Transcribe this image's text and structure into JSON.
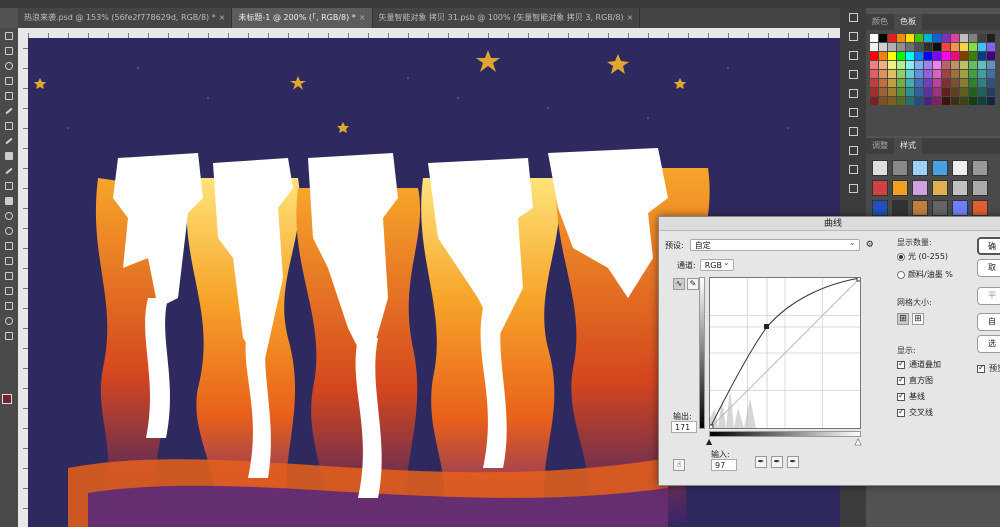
{
  "tabs": [
    {
      "label": "热浪来袭.psd @ 153% (56fe2f778629d, RGB/8) *",
      "active": false
    },
    {
      "label": "未标题-1 @ 200% (「, RGB/8) *",
      "active": true
    },
    {
      "label": "矢量智能对象 拷贝 31.psb @ 100% (矢量智能对象 拷贝 3, RGB/8)",
      "active": false
    }
  ],
  "tab_close": "×",
  "panels": {
    "swatches": {
      "tabs": [
        "颜色",
        "色板"
      ],
      "active": "色板"
    },
    "styles": {
      "tabs": [
        "调整",
        "样式"
      ],
      "active": "样式"
    }
  },
  "curves": {
    "title": "曲线",
    "preset_label": "预设:",
    "preset_value": "自定",
    "channel_label": "通道:",
    "channel_value": "RGB",
    "output_label": "输出:",
    "output_value": "171",
    "input_label": "输入:",
    "input_value": "97",
    "show_amount": {
      "title": "显示数量:",
      "options": [
        {
          "label": "光 (0-255)",
          "selected": true
        },
        {
          "label": "颜料/油墨 %",
          "selected": false
        }
      ]
    },
    "grid_size": {
      "title": "网格大小:"
    },
    "show": {
      "title": "显示:",
      "options": [
        {
          "label": "通道叠加",
          "checked": true
        },
        {
          "label": "直方图",
          "checked": true
        },
        {
          "label": "基线",
          "checked": true
        },
        {
          "label": "交叉线",
          "checked": true
        }
      ]
    },
    "buttons": {
      "ok": "确",
      "cancel": "取",
      "smooth": "平",
      "auto": "自",
      "options": "选"
    },
    "preview_label": "预览"
  },
  "colors": {
    "canvas_bg": "#2e2a60",
    "accent_orange": "#f28a1c",
    "star": "#e0a630"
  }
}
